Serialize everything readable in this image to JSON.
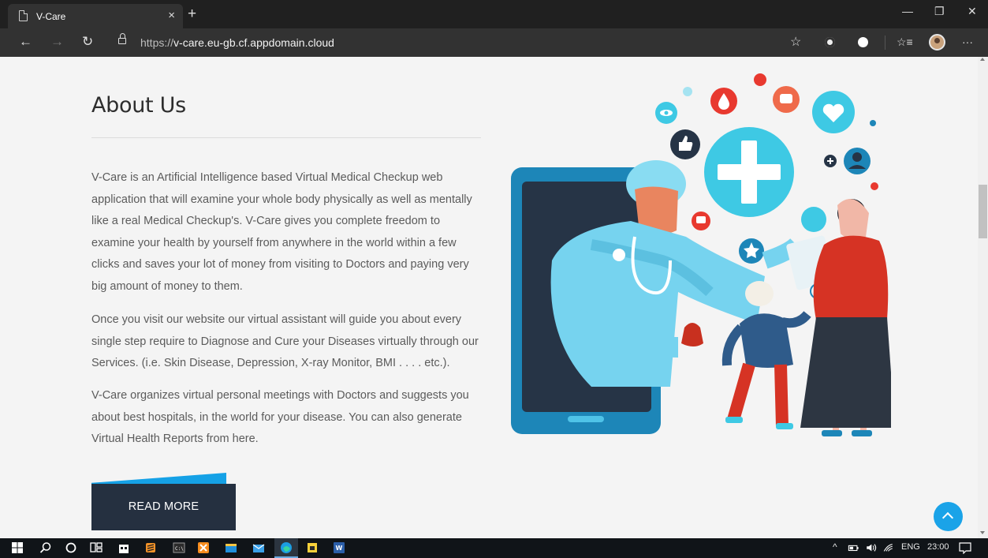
{
  "browser": {
    "tab_title": "V-Care",
    "tab_close": "×",
    "new_tab": "+",
    "url_protocol": "https://",
    "url_host": "v-care.eu-gb.cf.appdomain.cloud",
    "window_controls": {
      "minimize": "—",
      "restore": "❐",
      "close": "✕"
    },
    "nav": {
      "back": "←",
      "forward": "→",
      "refresh": "↻"
    },
    "toolbar": {
      "favorite": "☆",
      "favorites_bar": "☆≡",
      "menu": "···"
    }
  },
  "about": {
    "title": "About Us",
    "paragraphs": [
      "V-Care is an Artificial Intelligence based Virtual Medical Checkup web application that will examine your whole body physically as well as mentally like a real Medical Checkup's. V-Care gives you complete freedom to examine your health by yourself from anywhere in the world within a few clicks and saves your lot of money from visiting to Doctors and paying very big amount of money to them.",
      "Once you visit our website our virtual assistant will guide you about every single step require to Diagnose and Cure your Diseases virtually through our Services. (i.e. Skin Disease, Depression, X-ray Monitor, BMI . . . . etc.).",
      "V-Care organizes virtual personal meetings with Doctors and suggests you about best hospitals, in the world for your disease. You can also generate Virtual Health Reports from here."
    ],
    "read_more": "READ MORE"
  },
  "taskbar": {
    "tray_language": "ENG",
    "tray_time": "23:00",
    "tray_chevron": "^"
  },
  "colors": {
    "accent_blue": "#15a1e6",
    "button_dark": "#253040",
    "cyan": "#3ec9e4",
    "red": "#e8392f"
  }
}
